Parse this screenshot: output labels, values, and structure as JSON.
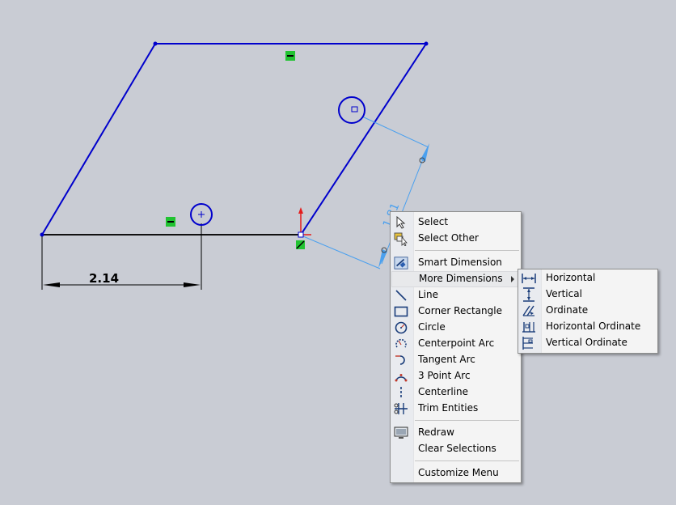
{
  "sketch": {
    "dimension_bottom": "2.14",
    "dimension_right": "1.81"
  },
  "context_menu": {
    "items": [
      {
        "label": "Select",
        "icon": "cursor-arrow-icon"
      },
      {
        "label": "Select Other",
        "icon": "select-other-icon"
      },
      {
        "label": "Smart Dimension",
        "icon": "smart-dimension-icon"
      },
      {
        "label": "More Dimensions",
        "icon": "",
        "has_submenu": true
      },
      {
        "label": "Line",
        "icon": "line-icon"
      },
      {
        "label": "Corner Rectangle",
        "icon": "rectangle-icon"
      },
      {
        "label": "Circle",
        "icon": "circle-icon"
      },
      {
        "label": "Centerpoint Arc",
        "icon": "centerpoint-arc-icon"
      },
      {
        "label": "Tangent Arc",
        "icon": "tangent-arc-icon"
      },
      {
        "label": "3 Point Arc",
        "icon": "three-point-arc-icon"
      },
      {
        "label": "Centerline",
        "icon": "centerline-icon"
      },
      {
        "label": "Trim Entities",
        "icon": "trim-icon"
      },
      {
        "label": "Redraw",
        "icon": "redraw-icon"
      },
      {
        "label": "Clear Selections",
        "icon": ""
      },
      {
        "label": "Customize Menu",
        "icon": ""
      }
    ]
  },
  "submenu": {
    "items": [
      {
        "label": "Horizontal",
        "icon": "horizontal-dimension-icon"
      },
      {
        "label": "Vertical",
        "icon": "vertical-dimension-icon"
      },
      {
        "label": "Ordinate",
        "icon": "ordinate-dimension-icon"
      },
      {
        "label": "Horizontal Ordinate",
        "icon": "horizontal-ordinate-icon"
      },
      {
        "label": "Vertical Ordinate",
        "icon": "vertical-ordinate-icon"
      }
    ]
  },
  "colors": {
    "sketch_blue": "#0000cc",
    "dimension_blue": "#4aa0ef",
    "relation_green": "#21c331",
    "origin_red": "#e41b1b",
    "background": "#c9ccd4"
  }
}
